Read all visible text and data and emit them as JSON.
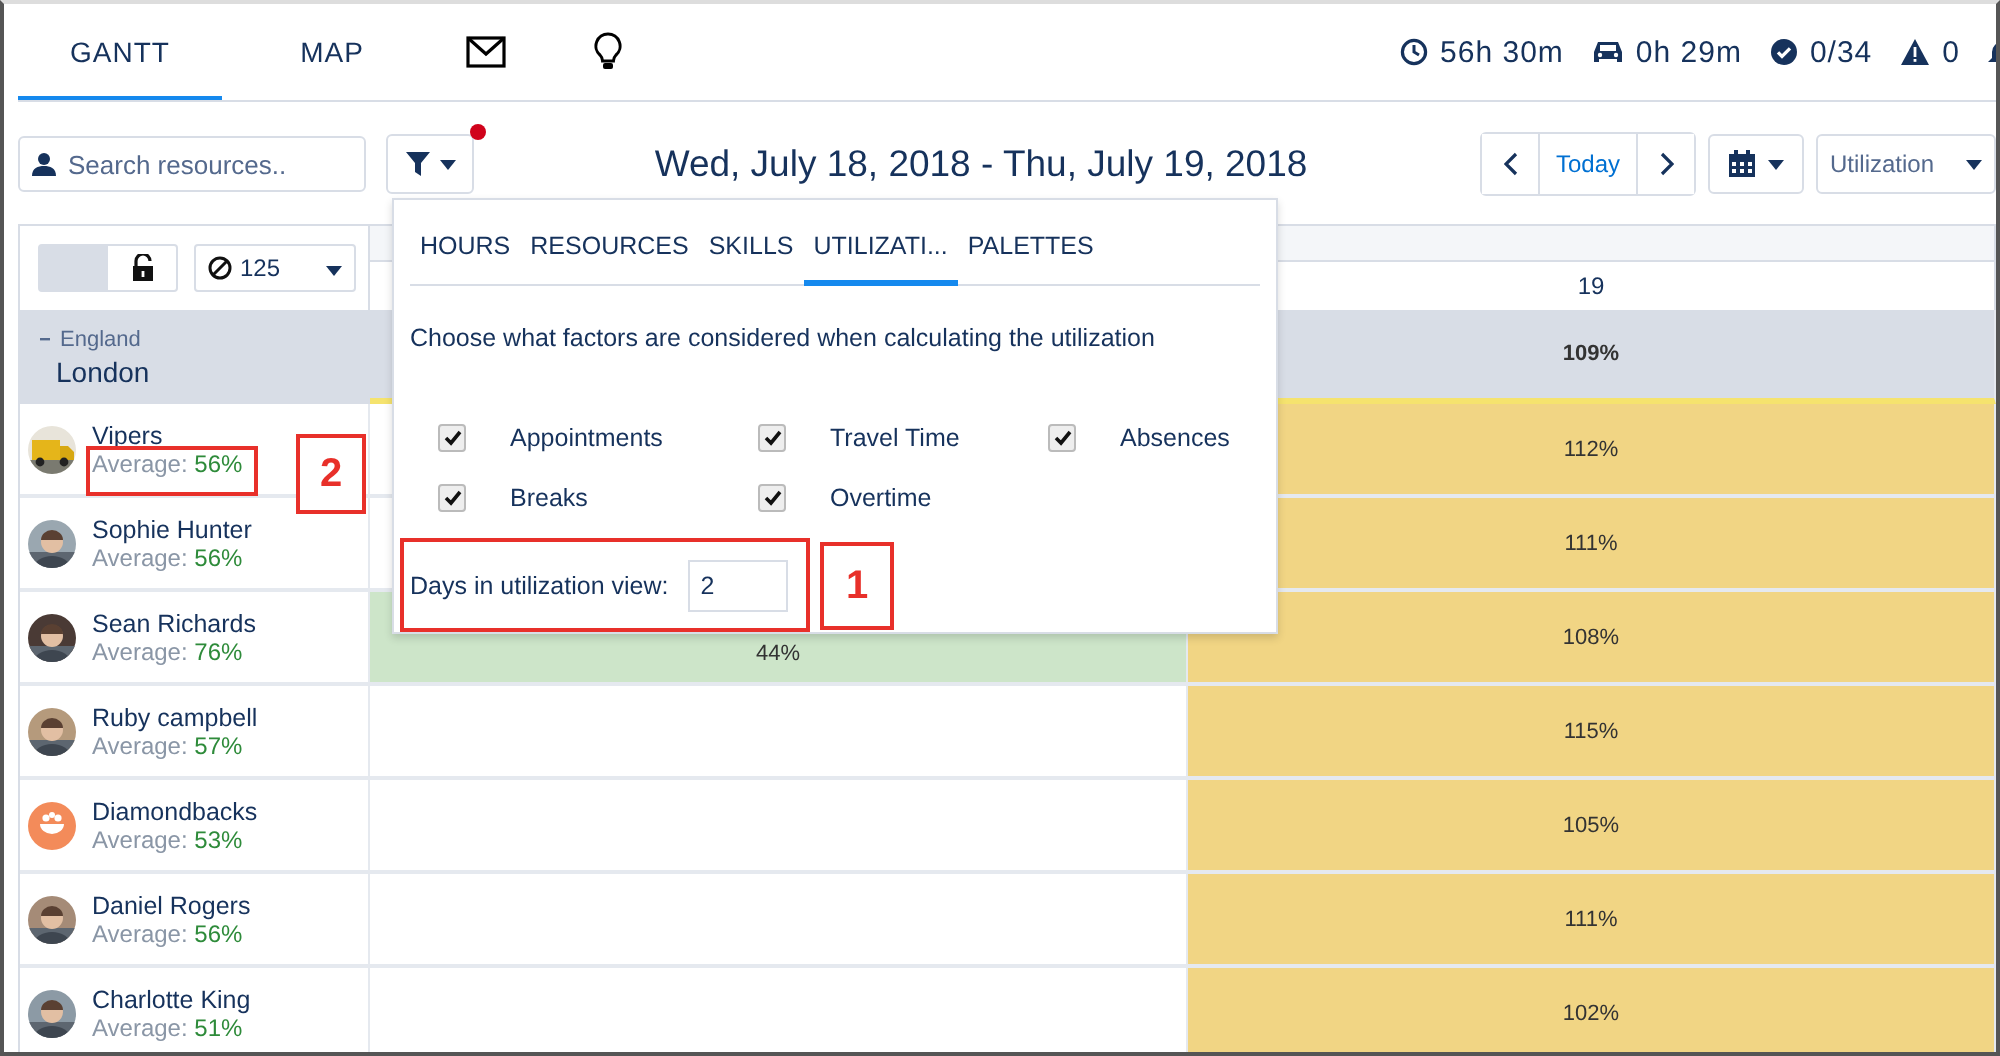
{
  "top_tabs": [
    {
      "label": "GANTT",
      "kind": "text",
      "selected": true
    },
    {
      "label": "MAP",
      "kind": "text",
      "selected": false
    },
    {
      "kind": "mail"
    },
    {
      "kind": "bulb"
    }
  ],
  "stats": [
    {
      "kind": "clock",
      "value": "56h 30m"
    },
    {
      "kind": "car",
      "value": "0h 29m"
    },
    {
      "kind": "check",
      "value": "0/34"
    },
    {
      "kind": "warning",
      "value": "0"
    },
    {
      "kind": "bell"
    }
  ],
  "search": {
    "placeholder": "Search resources.."
  },
  "filter": {
    "active": true
  },
  "date_range": "Wed, July 18, 2018 - Thu, July 19, 2018",
  "today_button": "Today",
  "view_select": "Utilization",
  "gantt_header": {
    "toggle_on": false,
    "limit": "125",
    "day_label": "19"
  },
  "group": {
    "parent": "England",
    "name": "London",
    "expanded": true,
    "cells": [
      {
        "kind": "group"
      },
      {
        "kind": "group",
        "text": "109%"
      }
    ]
  },
  "resources": [
    {
      "name": "Vipers",
      "average_label": "Average:",
      "average": "56%",
      "avatar": {
        "kind": "truck"
      },
      "cells": [
        {
          "kind": "empty"
        },
        {
          "kind": "over",
          "text": "112%"
        }
      ]
    },
    {
      "name": "Sophie Hunter",
      "average_label": "Average:",
      "average": "56%",
      "cells": [
        {
          "kind": "empty"
        },
        {
          "kind": "over",
          "text": "111%"
        }
      ]
    },
    {
      "name": "Sean Richards",
      "average_label": "Average:",
      "average": "76%",
      "cells": [
        {
          "kind": "under",
          "text": "44%"
        },
        {
          "kind": "over",
          "text": "108%"
        }
      ]
    },
    {
      "name": "Ruby campbell",
      "average_label": "Average:",
      "average": "57%",
      "cells": [
        {
          "kind": "empty"
        },
        {
          "kind": "over",
          "text": "115%"
        }
      ]
    },
    {
      "name": "Diamondbacks",
      "average_label": "Average:",
      "average": "53%",
      "avatar": {
        "kind": "icon"
      },
      "cells": [
        {
          "kind": "empty"
        },
        {
          "kind": "over",
          "text": "105%"
        }
      ]
    },
    {
      "name": "Daniel Rogers",
      "average_label": "Average:",
      "average": "56%",
      "cells": [
        {
          "kind": "empty"
        },
        {
          "kind": "over",
          "text": "111%"
        }
      ]
    },
    {
      "name": "Charlotte King",
      "average_label": "Average:",
      "average": "51%",
      "cells": [
        {
          "kind": "empty"
        },
        {
          "kind": "over",
          "text": "102%"
        }
      ]
    }
  ],
  "popup": {
    "tabs": [
      {
        "label": "HOURS",
        "selected": false
      },
      {
        "label": "RESOURCES",
        "selected": false
      },
      {
        "label": "SKILLS",
        "selected": false
      },
      {
        "label": "UTILIZATI...",
        "selected": true
      },
      {
        "label": "PALETTES",
        "selected": false
      }
    ],
    "intro": "Choose what factors are considered when calculating the utilization",
    "factors": [
      {
        "label": "Appointments",
        "checked": true
      },
      {
        "label": "Travel Time",
        "checked": true
      },
      {
        "label": "Absences",
        "checked": true
      },
      {
        "label": "Breaks",
        "checked": true
      },
      {
        "label": "Overtime",
        "checked": true
      }
    ],
    "days_label": "Days in utilization view:",
    "days_value": "2"
  },
  "callouts": [
    {
      "label": "1"
    },
    {
      "label": "2"
    }
  ]
}
